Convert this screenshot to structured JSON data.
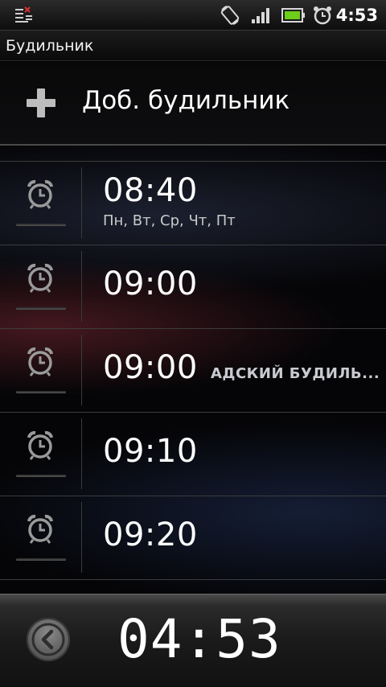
{
  "status_bar": {
    "time": "4:53",
    "icons": [
      "notification-icon",
      "rotate-icon",
      "signal-icon",
      "battery-icon",
      "alarm-clock-icon"
    ]
  },
  "title": "Будильник",
  "add_alarm": {
    "label": "Доб. будильник",
    "icon": "plus-icon"
  },
  "alarms": [
    {
      "time": "08:40",
      "days": "Пн, Вт, Ср, Чт, Пт",
      "label": ""
    },
    {
      "time": "09:00",
      "days": "",
      "label": ""
    },
    {
      "time": "09:00",
      "days": "",
      "label": "АДСКИЙ БУДИЛЬ..."
    },
    {
      "time": "09:10",
      "days": "",
      "label": ""
    },
    {
      "time": "09:20",
      "days": "",
      "label": ""
    }
  ],
  "bottom_bar": {
    "clock": "04:53",
    "back_icon": "back-arrow-icon"
  }
}
